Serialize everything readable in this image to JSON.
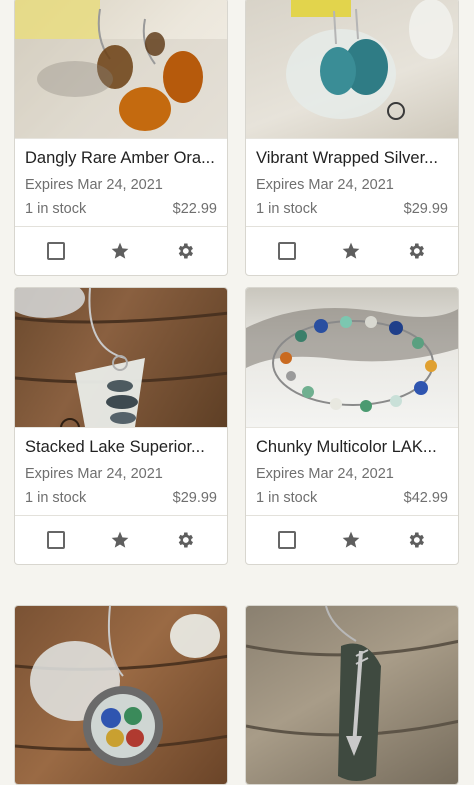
{
  "listings": [
    {
      "title": "Dangly Rare Amber Ora...",
      "expires": "Expires Mar 24, 2021",
      "stock": "1 in stock",
      "price": "$22.99",
      "image": "amber-sea-glass-earrings"
    },
    {
      "title": "Vibrant Wrapped Silver...",
      "expires": "Expires Mar 24, 2021",
      "stock": "1 in stock",
      "price": "$29.99",
      "image": "teal-wrapped-sea-glass-earrings"
    },
    {
      "title": "Stacked Lake Superior...",
      "expires": "Expires Mar 24, 2021",
      "stock": "1 in stock",
      "price": "$29.99",
      "image": "stacked-stone-sea-glass-pendant"
    },
    {
      "title": "Chunky Multicolor LAK...",
      "expires": "Expires Mar 24, 2021",
      "stock": "1 in stock",
      "price": "$42.99",
      "image": "multicolor-sea-glass-bracelet"
    },
    {
      "title": "",
      "expires": "",
      "stock": "",
      "price": "",
      "image": "locket-sea-glass-necklace"
    },
    {
      "title": "",
      "expires": "",
      "stock": "",
      "price": "",
      "image": "arrow-stone-pendant"
    }
  ],
  "icons": {
    "checkbox": "checkbox-icon",
    "star": "star-icon",
    "settings": "gear-icon"
  },
  "colors": {
    "background": "#f5f4ef",
    "icon": "#5e5e5e"
  }
}
